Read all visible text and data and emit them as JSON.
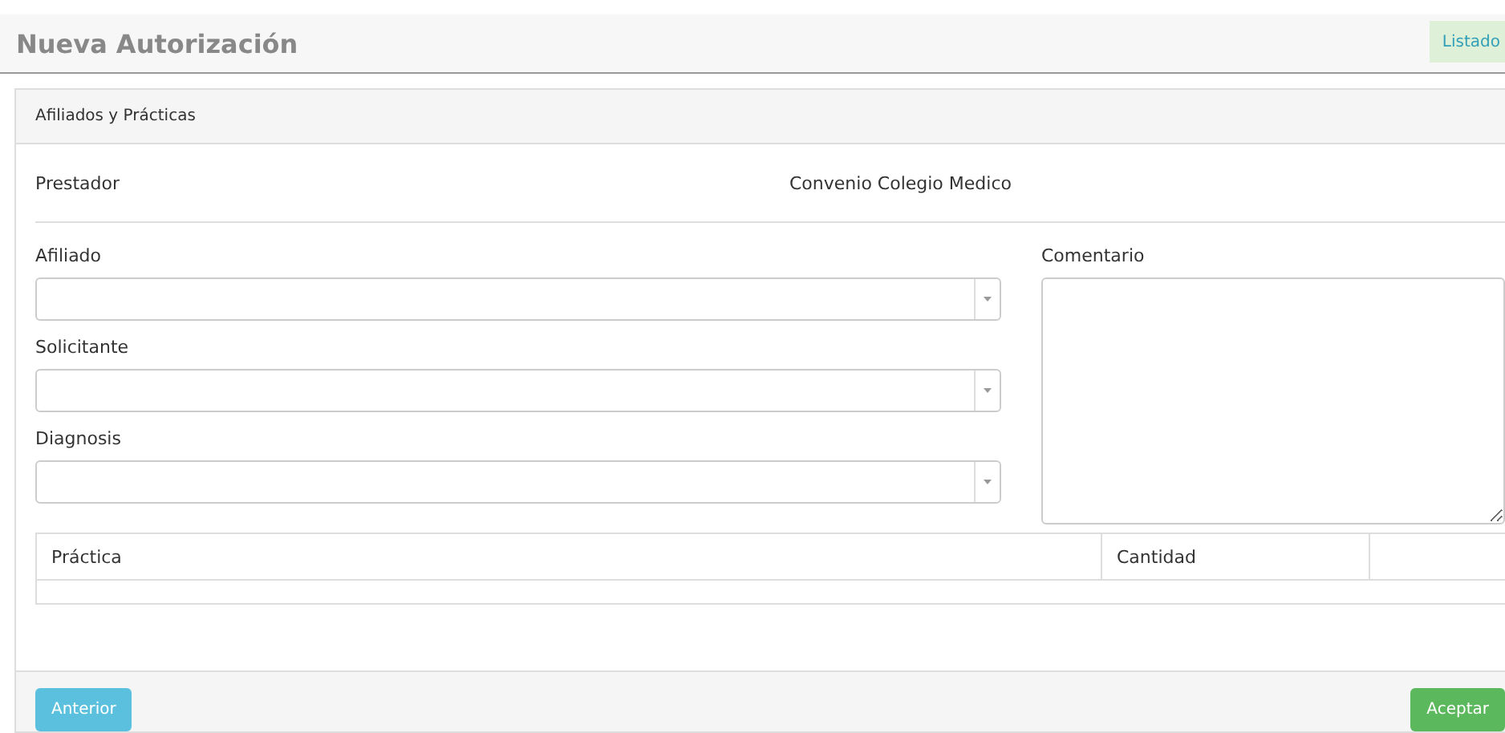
{
  "header": {
    "title": "Nueva Autorización",
    "list_button": "Listado"
  },
  "panel": {
    "title": "Afiliados y Prácticas",
    "provider": {
      "label": "Prestador",
      "value": "Convenio Colegio Medico"
    },
    "selects": [
      {
        "label": "Afiliado"
      },
      {
        "label": "Solicitante"
      },
      {
        "label": "Diagnosis"
      }
    ],
    "comment": {
      "label": "Comentario"
    },
    "table": {
      "columns": [
        "Práctica",
        "Cantidad"
      ]
    }
  },
  "footer": {
    "back_button": "Anterior",
    "accept_button": "Aceptar"
  }
}
